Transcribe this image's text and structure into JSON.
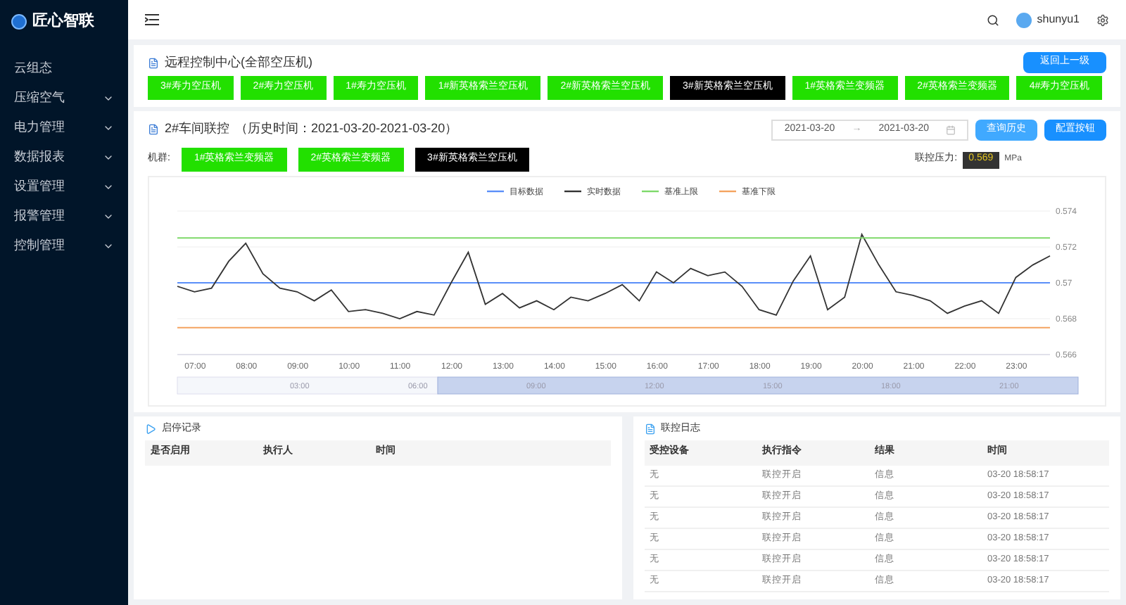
{
  "brand": "匠心智联",
  "sidebar": {
    "items": [
      {
        "label": "云组态",
        "has_submenu": false
      },
      {
        "label": "压缩空气",
        "has_submenu": true
      },
      {
        "label": "电力管理",
        "has_submenu": true
      },
      {
        "label": "数据报表",
        "has_submenu": true
      },
      {
        "label": "设置管理",
        "has_submenu": true
      },
      {
        "label": "报警管理",
        "has_submenu": true
      },
      {
        "label": "控制管理",
        "has_submenu": true
      }
    ]
  },
  "header": {
    "username": "shunyu1"
  },
  "remote_panel": {
    "title": "远程控制中心(全部空压机)",
    "back_button": "返回上一级",
    "machines": [
      {
        "label": "3#寿力空压机",
        "selected": false
      },
      {
        "label": "2#寿力空压机",
        "selected": false
      },
      {
        "label": "1#寿力空压机",
        "selected": false
      },
      {
        "label": "1#新英格索兰空压机",
        "selected": false
      },
      {
        "label": "2#新英格索兰空压机",
        "selected": false
      },
      {
        "label": "3#新英格索兰空压机",
        "selected": true
      },
      {
        "label": "1#英格索兰变频器",
        "selected": false
      },
      {
        "label": "2#英格索兰变频器",
        "selected": false
      },
      {
        "label": "4#寿力空压机",
        "selected": false
      }
    ]
  },
  "link_panel": {
    "title": "2#车间联控",
    "history": "（历史时间：2021-03-20-2021-03-20）",
    "date_start": "2021-03-20",
    "date_end": "2021-03-20",
    "date_separator": "→",
    "query_button": "查询历史",
    "config_button": "配置按钮",
    "machines_label": "机群:",
    "machines": [
      {
        "label": "1#英格索兰变频器",
        "selected": false
      },
      {
        "label": "2#英格索兰变频器",
        "selected": false
      },
      {
        "label": "3#新英格索兰空压机",
        "selected": true
      }
    ],
    "pressure_label": "联控压力:",
    "pressure_value": "0.569",
    "pressure_unit": "MPa",
    "chart_data": {
      "type": "line",
      "legend": "top",
      "x": [
        400,
        420,
        440,
        460,
        480,
        500,
        520,
        540,
        560,
        580,
        600,
        620,
        640,
        660,
        680,
        700,
        720,
        740,
        760,
        780,
        800,
        820,
        840,
        860,
        880,
        900,
        920,
        940,
        960,
        980,
        1000,
        1020,
        1040,
        1060,
        1080,
        1100,
        1120,
        1140,
        1160,
        1180,
        1200,
        1220,
        1240,
        1260,
        1280,
        1300,
        1320,
        1340,
        1360,
        1380,
        1400,
        1420
      ],
      "xlim": [
        400,
        1420
      ],
      "xticks": [
        {
          "value": 420,
          "label": "07:00"
        },
        {
          "value": 480,
          "label": "08:00"
        },
        {
          "value": 540,
          "label": "09:00"
        },
        {
          "value": 600,
          "label": "10:00"
        },
        {
          "value": 660,
          "label": "11:00"
        },
        {
          "value": 720,
          "label": "12:00"
        },
        {
          "value": 780,
          "label": "13:00"
        },
        {
          "value": 840,
          "label": "14:00"
        },
        {
          "value": 900,
          "label": "15:00"
        },
        {
          "value": 960,
          "label": "16:00"
        },
        {
          "value": 1020,
          "label": "17:00"
        },
        {
          "value": 1080,
          "label": "18:00"
        },
        {
          "value": 1140,
          "label": "19:00"
        },
        {
          "value": 1200,
          "label": "20:00"
        },
        {
          "value": 1260,
          "label": "21:00"
        },
        {
          "value": 1320,
          "label": "22:00"
        },
        {
          "value": 1380,
          "label": "23:00"
        }
      ],
      "ylim": [
        0.566,
        0.574
      ],
      "yticks": [
        0.566,
        0.568,
        0.57,
        0.572,
        0.574
      ],
      "series": [
        {
          "name": "目标数据",
          "color": "#5b8ff9",
          "values": [
            0.57,
            0.57,
            0.57,
            0.57,
            0.57,
            0.57,
            0.57,
            0.57,
            0.57,
            0.57,
            0.57,
            0.57,
            0.57,
            0.57,
            0.57,
            0.57,
            0.57,
            0.57,
            0.57,
            0.57,
            0.57,
            0.57,
            0.57,
            0.57,
            0.57,
            0.57,
            0.57,
            0.57,
            0.57,
            0.57,
            0.57,
            0.57,
            0.57,
            0.57,
            0.57,
            0.57,
            0.57,
            0.57,
            0.57,
            0.57,
            0.57,
            0.57,
            0.57,
            0.57,
            0.57,
            0.57,
            0.57,
            0.57,
            0.57,
            0.57,
            0.57,
            0.57
          ]
        },
        {
          "name": "实时数据",
          "color": "#333333",
          "values": [
            0.5698,
            0.5695,
            0.5697,
            0.5712,
            0.5722,
            0.5705,
            0.5697,
            0.5695,
            0.569,
            0.5696,
            0.5684,
            0.5685,
            0.5683,
            0.568,
            0.5684,
            0.5682,
            0.57,
            0.5717,
            0.5688,
            0.5694,
            0.5686,
            0.569,
            0.5685,
            0.5692,
            0.569,
            0.5694,
            0.5699,
            0.569,
            0.5706,
            0.57,
            0.5708,
            0.5704,
            0.5706,
            0.5698,
            0.5685,
            0.5682,
            0.5701,
            0.5715,
            0.5685,
            0.5692,
            0.5727,
            0.571,
            0.5695,
            0.5693,
            0.569,
            0.5683,
            0.5687,
            0.569,
            0.5683,
            0.5703,
            0.571,
            0.5715
          ]
        },
        {
          "name": "基准上限",
          "color": "#7ed96a",
          "values": [
            0.5725,
            0.5725,
            0.5725,
            0.5725,
            0.5725,
            0.5725,
            0.5725,
            0.5725,
            0.5725,
            0.5725,
            0.5725,
            0.5725,
            0.5725,
            0.5725,
            0.5725,
            0.5725,
            0.5725,
            0.5725,
            0.5725,
            0.5725,
            0.5725,
            0.5725,
            0.5725,
            0.5725,
            0.5725,
            0.5725,
            0.5725,
            0.5725,
            0.5725,
            0.5725,
            0.5725,
            0.5725,
            0.5725,
            0.5725,
            0.5725,
            0.5725,
            0.5725,
            0.5725,
            0.5725,
            0.5725,
            0.5725,
            0.5725,
            0.5725,
            0.5725,
            0.5725,
            0.5725,
            0.5725,
            0.5725,
            0.5725,
            0.5725,
            0.5725,
            0.5725
          ]
        },
        {
          "name": "基准下限",
          "color": "#f4a360",
          "values": [
            0.5675,
            0.5675,
            0.5675,
            0.5675,
            0.5675,
            0.5675,
            0.5675,
            0.5675,
            0.5675,
            0.5675,
            0.5675,
            0.5675,
            0.5675,
            0.5675,
            0.5675,
            0.5675,
            0.5675,
            0.5675,
            0.5675,
            0.5675,
            0.5675,
            0.5675,
            0.5675,
            0.5675,
            0.5675,
            0.5675,
            0.5675,
            0.5675,
            0.5675,
            0.5675,
            0.5675,
            0.5675,
            0.5675,
            0.5675,
            0.5675,
            0.5675,
            0.5675,
            0.5675,
            0.5675,
            0.5675,
            0.5675,
            0.5675,
            0.5675,
            0.5675,
            0.5675,
            0.5675,
            0.5675,
            0.5675,
            0.5675,
            0.5675,
            0.5675,
            0.5675
          ]
        }
      ]
    },
    "zoom_slider_labels": [
      "03:00",
      "06:00",
      "09:00",
      "12:00",
      "15:00",
      "18:00",
      "21:00"
    ]
  },
  "start_stop_panel": {
    "title": "启停记录",
    "columns": [
      "是否启用",
      "执行人",
      "时间"
    ]
  },
  "log_panel": {
    "title": "联控日志",
    "columns": [
      "受控设备",
      "执行指令",
      "结果",
      "时间"
    ],
    "rows": [
      [
        "无",
        "联控开启",
        "信息",
        "03-20 18:58:17"
      ],
      [
        "无",
        "联控开启",
        "信息",
        "03-20 18:58:17"
      ],
      [
        "无",
        "联控开启",
        "信息",
        "03-20 18:58:17"
      ],
      [
        "无",
        "联控开启",
        "信息",
        "03-20 18:58:17"
      ],
      [
        "无",
        "联控开启",
        "信息",
        "03-20 18:58:17"
      ],
      [
        "无",
        "联控开启",
        "信息",
        "03-20 18:58:17"
      ]
    ]
  }
}
